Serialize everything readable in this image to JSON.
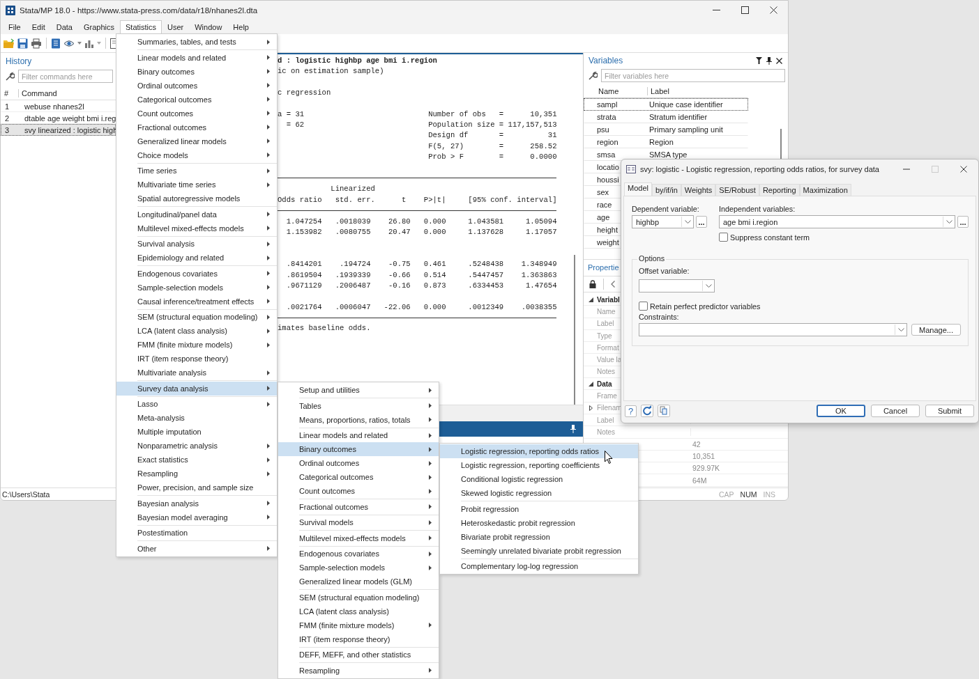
{
  "window": {
    "title": "Stata/MP 18.0 - https://www.stata-press.com/data/r18/nhanes2l.dta"
  },
  "menu_bar": [
    {
      "label": "File",
      "selected": false
    },
    {
      "label": "Edit",
      "selected": false
    },
    {
      "label": "Data",
      "selected": false
    },
    {
      "label": "Graphics",
      "selected": false
    },
    {
      "label": "Statistics",
      "selected": true
    },
    {
      "label": "User",
      "selected": false
    },
    {
      "label": "Window",
      "selected": false
    },
    {
      "label": "Help",
      "selected": false
    }
  ],
  "history": {
    "title": "History",
    "search": {
      "placeholder": "Filter commands here"
    },
    "columns": [
      "#",
      "Command"
    ],
    "rows": [
      {
        "number": "1",
        "command": "webuse nhanes2l",
        "selected": false
      },
      {
        "number": "2",
        "command": "dtable age weight bmi i.reg",
        "selected": false
      },
      {
        "number": "3",
        "command": "svy linearized : logistic high",
        "selected": true
      }
    ]
  },
  "results": {
    "lines": [
      {
        "kind": "command",
        "text": "d : logistic highbp age bmi i.region"
      },
      {
        "kind": "output",
        "text": "ic on estimation sample)"
      },
      {
        "kind": "blank"
      },
      {
        "kind": "output",
        "text": "c regression"
      },
      {
        "kind": "blank"
      },
      {
        "kind": "output",
        "text": "a = 31                            Number of obs   =      10,351"
      },
      {
        "kind": "output",
        "text": "  = 62                            Population size = 117,157,513"
      },
      {
        "kind": "output",
        "text": "                                  Design df       =          31"
      },
      {
        "kind": "output",
        "text": "                                  F(5, 27)        =      258.52"
      },
      {
        "kind": "output",
        "text": "                                  Prob > F        =      0.0000"
      },
      {
        "kind": "blank"
      },
      {
        "kind": "rule"
      },
      {
        "kind": "output",
        "text": "            Linearized"
      },
      {
        "kind": "output",
        "text": "Odds ratio   std. err.      t    P>|t|     [95% conf. interval]"
      },
      {
        "kind": "rule"
      },
      {
        "kind": "output",
        "text": "  1.047254   .0018039    26.80   0.000     1.043581     1.05094"
      },
      {
        "kind": "output",
        "text": "  1.153982   .0080755    20.47   0.000     1.137628     1.17057"
      },
      {
        "kind": "blank"
      },
      {
        "kind": "blank"
      },
      {
        "kind": "output",
        "text": "  .8414201    .194724    -0.75   0.461     .5248438    1.348949"
      },
      {
        "kind": "output",
        "text": "  .8619504   .1939339    -0.66   0.514     .5447457    1.363863"
      },
      {
        "kind": "output",
        "text": "  .9671129   .2006487    -0.16   0.873     .6334453     1.47654"
      },
      {
        "kind": "blank"
      },
      {
        "kind": "output",
        "text": "  .0021764   .0006047   -22.06   0.000     .0012349    .0038355"
      },
      {
        "kind": "rule"
      },
      {
        "kind": "output",
        "text": "imates baseline odds."
      }
    ]
  },
  "variables": {
    "title": "Variables",
    "search": {
      "placeholder": "Filter variables here"
    },
    "columns": [
      "Name",
      "Label"
    ],
    "rows": [
      {
        "name": "sampl",
        "label": "Unique case identifier",
        "focused": true
      },
      {
        "name": "strata",
        "label": "Stratum identifier",
        "focused": false
      },
      {
        "name": "psu",
        "label": "Primary sampling unit",
        "focused": false
      },
      {
        "name": "region",
        "label": "Region",
        "focused": false
      },
      {
        "name": "smsa",
        "label": "SMSA type",
        "focused": false
      },
      {
        "name": "locatio",
        "focused": false
      },
      {
        "name": "houssi",
        "focused": false
      },
      {
        "name": "sex",
        "focused": false
      },
      {
        "name": "race",
        "focused": false
      },
      {
        "name": "age",
        "focused": false
      },
      {
        "name": "height",
        "focused": false
      },
      {
        "name": "weight",
        "focused": false
      }
    ]
  },
  "properties": {
    "title": "Propertie",
    "sections": [
      {
        "title": "Variabl",
        "expanded": true,
        "rows": [
          {
            "name": "Name",
            "expandable": false
          },
          {
            "name": "Label",
            "expandable": false
          },
          {
            "name": "Type",
            "expandable": false
          },
          {
            "name": "Format",
            "expandable": false
          },
          {
            "name": "Value la",
            "expandable": false
          },
          {
            "name": "Notes",
            "expandable": false
          }
        ]
      },
      {
        "title": "Data",
        "expanded": true,
        "rows": [
          {
            "name": "Frame",
            "expandable": false
          },
          {
            "name": "Filenam",
            "expandable": true
          },
          {
            "name": "Label",
            "expandable": false
          },
          {
            "name": "Notes",
            "expandable": false
          },
          {
            "value": "42",
            "expandable": false
          },
          {
            "value": "10,351",
            "expandable": false
          },
          {
            "value": "929.97K",
            "expandable": false
          },
          {
            "value": "64M",
            "expandable": false
          }
        ]
      }
    ]
  },
  "status_bar": {
    "path": "C:\\Users\\Stata",
    "indicators": [
      {
        "label": "CAP",
        "on": false
      },
      {
        "label": "NUM",
        "on": true
      },
      {
        "label": "INS",
        "on": false
      }
    ]
  },
  "statistics_menu": {
    "groups": [
      [
        {
          "label": "Summaries, tables, and tests",
          "submenu": true,
          "selected": false
        }
      ],
      [
        {
          "label": "Linear models and related",
          "submenu": true,
          "selected": false
        },
        {
          "label": "Binary outcomes",
          "submenu": true,
          "selected": false
        },
        {
          "label": "Ordinal outcomes",
          "submenu": true,
          "selected": false
        },
        {
          "label": "Categorical outcomes",
          "submenu": true,
          "selected": false
        },
        {
          "label": "Count outcomes",
          "submenu": true,
          "selected": false
        },
        {
          "label": "Fractional outcomes",
          "submenu": true,
          "selected": false
        },
        {
          "label": "Generalized linear models",
          "submenu": true,
          "selected": false
        },
        {
          "label": "Choice models",
          "submenu": true,
          "selected": false
        }
      ],
      [
        {
          "label": "Time series",
          "submenu": true,
          "selected": false
        },
        {
          "label": "Multivariate time series",
          "submenu": true,
          "selected": false
        },
        {
          "label": "Spatial autoregressive models",
          "submenu": false,
          "selected": false
        }
      ],
      [
        {
          "label": "Longitudinal/panel data",
          "submenu": true,
          "selected": false
        },
        {
          "label": "Multilevel mixed-effects models",
          "submenu": true,
          "selected": false
        }
      ],
      [
        {
          "label": "Survival analysis",
          "submenu": true,
          "selected": false
        },
        {
          "label": "Epidemiology and related",
          "submenu": true,
          "selected": false
        }
      ],
      [
        {
          "label": "Endogenous covariates",
          "submenu": true,
          "selected": false
        },
        {
          "label": "Sample-selection models",
          "submenu": true,
          "selected": false
        },
        {
          "label": "Causal inference/treatment effects",
          "submenu": true,
          "selected": false
        }
      ],
      [
        {
          "label": "SEM (structural equation modeling)",
          "submenu": true,
          "selected": false
        },
        {
          "label": "LCA (latent class analysis)",
          "submenu": true,
          "selected": false
        },
        {
          "label": "FMM (finite mixture models)",
          "submenu": true,
          "selected": false
        },
        {
          "label": "IRT (item response theory)",
          "submenu": false,
          "selected": false
        },
        {
          "label": "Multivariate analysis",
          "submenu": true,
          "selected": false
        }
      ],
      [
        {
          "label": "Survey data analysis",
          "submenu": true,
          "selected": true
        }
      ],
      [
        {
          "label": "Lasso",
          "submenu": true,
          "selected": false
        },
        {
          "label": "Meta-analysis",
          "submenu": false,
          "selected": false
        },
        {
          "label": "Multiple imputation",
          "submenu": false,
          "selected": false
        },
        {
          "label": "Nonparametric analysis",
          "submenu": true,
          "selected": false
        },
        {
          "label": "Exact statistics",
          "submenu": true,
          "selected": false
        },
        {
          "label": "Resampling",
          "submenu": true,
          "selected": false
        },
        {
          "label": "Power, precision, and sample size",
          "submenu": false,
          "selected": false
        }
      ],
      [
        {
          "label": "Bayesian analysis",
          "submenu": true,
          "selected": false
        },
        {
          "label": "Bayesian model averaging",
          "submenu": true,
          "selected": false
        }
      ],
      [
        {
          "label": "Postestimation",
          "submenu": false,
          "selected": false
        }
      ],
      [
        {
          "label": "Other",
          "submenu": true,
          "selected": false
        }
      ]
    ]
  },
  "survey_menu": {
    "groups": [
      [
        {
          "label": "Setup and utilities",
          "submenu": true,
          "selected": false
        }
      ],
      [
        {
          "label": "Tables",
          "submenu": true,
          "selected": false
        },
        {
          "label": "Means, proportions, ratios, totals",
          "submenu": true,
          "selected": false
        }
      ],
      [
        {
          "label": "Linear models and related",
          "submenu": true,
          "selected": false
        },
        {
          "label": "Binary outcomes",
          "submenu": true,
          "selected": true
        },
        {
          "label": "Ordinal outcomes",
          "submenu": true,
          "selected": false
        },
        {
          "label": "Categorical outcomes",
          "submenu": true,
          "selected": false
        },
        {
          "label": "Count outcomes",
          "submenu": true,
          "selected": false
        }
      ],
      [
        {
          "label": "Fractional outcomes",
          "submenu": true,
          "selected": false
        }
      ],
      [
        {
          "label": "Survival models",
          "submenu": true,
          "selected": false
        }
      ],
      [
        {
          "label": "Multilevel mixed-effects models",
          "submenu": true,
          "selected": false
        }
      ],
      [
        {
          "label": "Endogenous covariates",
          "submenu": true,
          "selected": false
        },
        {
          "label": "Sample-selection models",
          "submenu": true,
          "selected": false
        },
        {
          "label": "Generalized linear models (GLM)",
          "submenu": false,
          "selected": false
        }
      ],
      [
        {
          "label": "SEM (structural equation modeling)",
          "submenu": false,
          "selected": false
        },
        {
          "label": "LCA (latent class analysis)",
          "submenu": false,
          "selected": false
        },
        {
          "label": "FMM (finite mixture models)",
          "submenu": true,
          "selected": false
        },
        {
          "label": "IRT (item response theory)",
          "submenu": false,
          "selected": false
        }
      ],
      [
        {
          "label": "DEFF, MEFF, and other statistics",
          "submenu": false,
          "selected": false
        }
      ],
      [
        {
          "label": "Resampling",
          "submenu": true,
          "selected": false
        }
      ]
    ]
  },
  "binary_menu": {
    "groups": [
      [
        {
          "label": "Logistic regression, reporting odds ratios",
          "submenu": false,
          "selected": true
        },
        {
          "label": "Logistic regression, reporting coefficients",
          "submenu": false,
          "selected": false
        },
        {
          "label": "Conditional logistic regression",
          "submenu": false,
          "selected": false
        },
        {
          "label": "Skewed logistic regression",
          "submenu": false,
          "selected": false
        }
      ],
      [
        {
          "label": "Probit regression",
          "submenu": false,
          "selected": false
        },
        {
          "label": "Heteroskedastic probit regression",
          "submenu": false,
          "selected": false
        },
        {
          "label": "Bivariate probit regression",
          "submenu": false,
          "selected": false
        },
        {
          "label": "Seemingly unrelated bivariate probit regression",
          "submenu": false,
          "selected": false
        }
      ],
      [
        {
          "label": "Complementary log-log regression",
          "submenu": false,
          "selected": false
        }
      ]
    ]
  },
  "dialog": {
    "title": "svy: logistic - Logistic regression, reporting odds ratios, for survey data",
    "tabs": [
      {
        "label": "Model",
        "selected": true
      },
      {
        "label": "by/if/in",
        "selected": false
      },
      {
        "label": "Weights",
        "selected": false
      },
      {
        "label": "SE/Robust",
        "selected": false
      },
      {
        "label": "Reporting",
        "selected": false
      },
      {
        "label": "Maximization",
        "selected": false
      }
    ],
    "dependent": {
      "label": "Dependent variable:",
      "value": "highbp",
      "browse": "..."
    },
    "independent": {
      "label": "Independent variables:",
      "value": "age bmi i.region",
      "browse": "..."
    },
    "suppress_constant": {
      "label": "Suppress constant term",
      "checked": false
    },
    "options": {
      "title": "Options",
      "offset": {
        "label": "Offset variable:"
      },
      "retain": {
        "label": "Retain perfect predictor variables",
        "checked": false
      },
      "constraints": {
        "label": "Constraints:"
      },
      "manage_button": "Manage..."
    },
    "help_button": "?",
    "buttons": [
      {
        "label": "OK",
        "default": true
      },
      {
        "label": "Cancel",
        "default": false
      },
      {
        "label": "Submit",
        "default": false
      }
    ]
  }
}
